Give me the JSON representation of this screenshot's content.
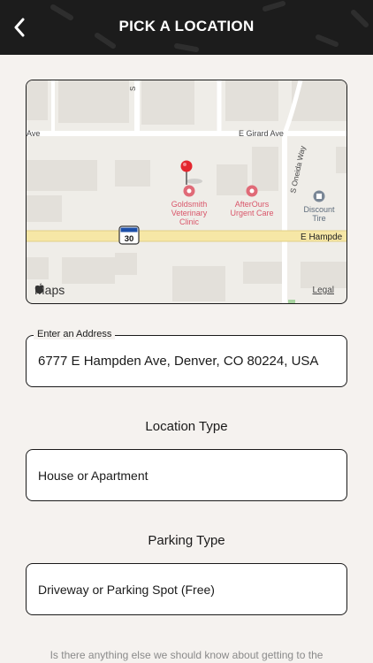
{
  "header": {
    "title": "PICK A LOCATION"
  },
  "map": {
    "streets": [
      "E Girard Ave",
      "Ave",
      "E Hampde",
      "S Oneida Way",
      "S"
    ],
    "route_shield": "30",
    "places": [
      {
        "name_line1": "Goldsmith",
        "name_line2": "Veterinary",
        "name_line3": "Clinic"
      },
      {
        "name_line1": "AfterOurs",
        "name_line2": "Urgent Care"
      },
      {
        "name_line1": "Discount",
        "name_line2": "Tire"
      }
    ],
    "attribution": "Maps",
    "legal": "Legal"
  },
  "address": {
    "label": "Enter an Address",
    "value": "6777 E Hampden Ave, Denver, CO 80224, USA"
  },
  "location_type": {
    "heading": "Location Type",
    "selected": "House or Apartment"
  },
  "parking_type": {
    "heading": "Parking Type",
    "selected": "Driveway or Parking Spot (Free)"
  },
  "footer_note": "Is there anything else we should know about getting to the",
  "colors": {
    "header_bg": "#1c1c1c",
    "page_bg": "#f5f2ef",
    "pin": "#e3262e",
    "poi": "#e06a77",
    "poi_gray": "#7a8796"
  }
}
